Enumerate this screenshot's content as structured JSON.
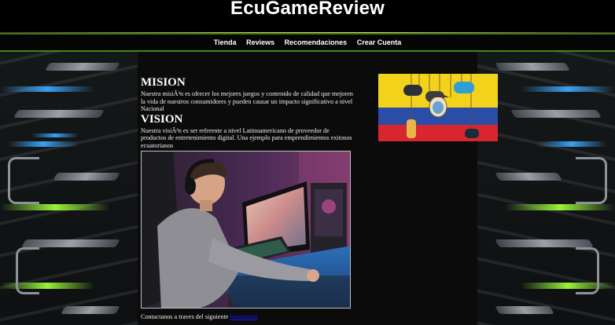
{
  "site": {
    "title": "EcuGameReview"
  },
  "nav": {
    "items": [
      {
        "label": "Tienda"
      },
      {
        "label": "Reviews"
      },
      {
        "label": "Recomendaciones"
      },
      {
        "label": "Crear Cuenta"
      }
    ]
  },
  "mision": {
    "heading": "MISION",
    "text": "Nuestra misiÃ³n es ofrecer los mejores juegos y contenido de calidad que mejoren la vida de nuestros consumidores y pueden causar un impacto significativo a nivel Nacional"
  },
  "vision": {
    "heading": "VISION",
    "text": "Nuestra visiÃ³n es ser referente a nivel Latinoamericano de proveedor de productos de entretenimiento digital. Una ejemplo para emprendimientos exitosos ecuatorianos"
  },
  "contact": {
    "text": "Contactanos a traves del siguiente ",
    "link_label": "formulario"
  },
  "colors": {
    "nav_accent": "#7fc42a",
    "link": "#1a1aff",
    "flag_yellow": "#f2d21b",
    "flag_blue": "#2a4ea8",
    "flag_red": "#d8262e"
  }
}
